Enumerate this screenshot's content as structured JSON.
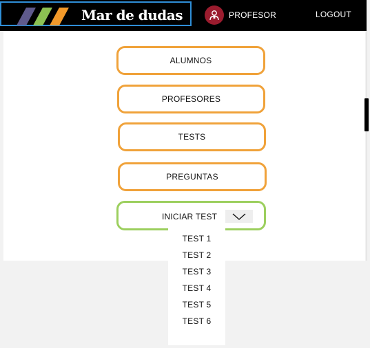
{
  "header": {
    "brand_title": "Mar de dudas",
    "user_label": "PROFESOR",
    "logout_label": "LOGOUT"
  },
  "menu": {
    "items": [
      {
        "label": "ALUMNOS"
      },
      {
        "label": "PROFESORES"
      },
      {
        "label": "TESTS"
      },
      {
        "label": "PREGUNTAS"
      }
    ],
    "start_test_label": "INICIAR TEST"
  },
  "dropdown": {
    "options": [
      "TEST 1",
      "TEST 2",
      "TEST 3",
      "TEST 4",
      "TEST 5",
      "TEST 6"
    ]
  },
  "colors": {
    "header_bg": "#000000",
    "brand_border": "#2f8fd8",
    "menu_border": "#f0a23a",
    "start_border": "#9ccf5e",
    "avatar_bg": "#9b1c2e",
    "stripe_purple": "#5f5a8c",
    "stripe_green": "#8cc152",
    "stripe_orange": "#f39a2a"
  }
}
